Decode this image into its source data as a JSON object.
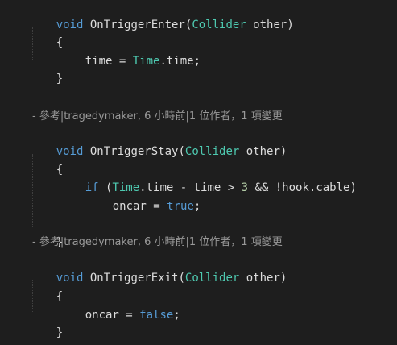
{
  "code": {
    "enter_void": "void",
    "enter_name": "OnTriggerEnter(",
    "enter_type": "Collider",
    "enter_param": " other)",
    "open_brace_1": "{",
    "time_assign_lhs": "time = ",
    "time_assign_type": "Time",
    "time_assign_rhs": ".time;",
    "close_brace_1": "}",
    "lens_1": "- 參考|tragedymaker, 6 小時前|1 位作者，1 項變更",
    "stay_void": "void",
    "stay_name": "OnTriggerStay(",
    "stay_type": "Collider",
    "stay_param": " other)",
    "open_brace_2": "{",
    "if_kw": "if",
    "if_open": " (",
    "if_type": "Time",
    "if_mid": ".time - time > ",
    "if_num": "3",
    "if_rest": " && !hook.cable)",
    "oncar_lhs_1": "oncar = ",
    "true_kw": "true",
    "semicolon_1": ";",
    "close_brace_2": "}",
    "lens_2": "- 參考|tragedymaker, 6 小時前|1 位作者，1 項變更",
    "exit_void": "void",
    "exit_name": "OnTriggerExit(",
    "exit_type": "Collider",
    "exit_param": " other)",
    "open_brace_3": "{",
    "oncar_lhs_2": "oncar = ",
    "false_kw": "false",
    "semicolon_2": ";",
    "close_brace_3": "}",
    "class_close_brace": "}"
  },
  "colors": {
    "background": "#1e1e1e",
    "keyword": "#569cd6",
    "type": "#4ec9b0",
    "identifier": "#dcdcdc",
    "number": "#b5cea8",
    "codelens": "#999999"
  }
}
